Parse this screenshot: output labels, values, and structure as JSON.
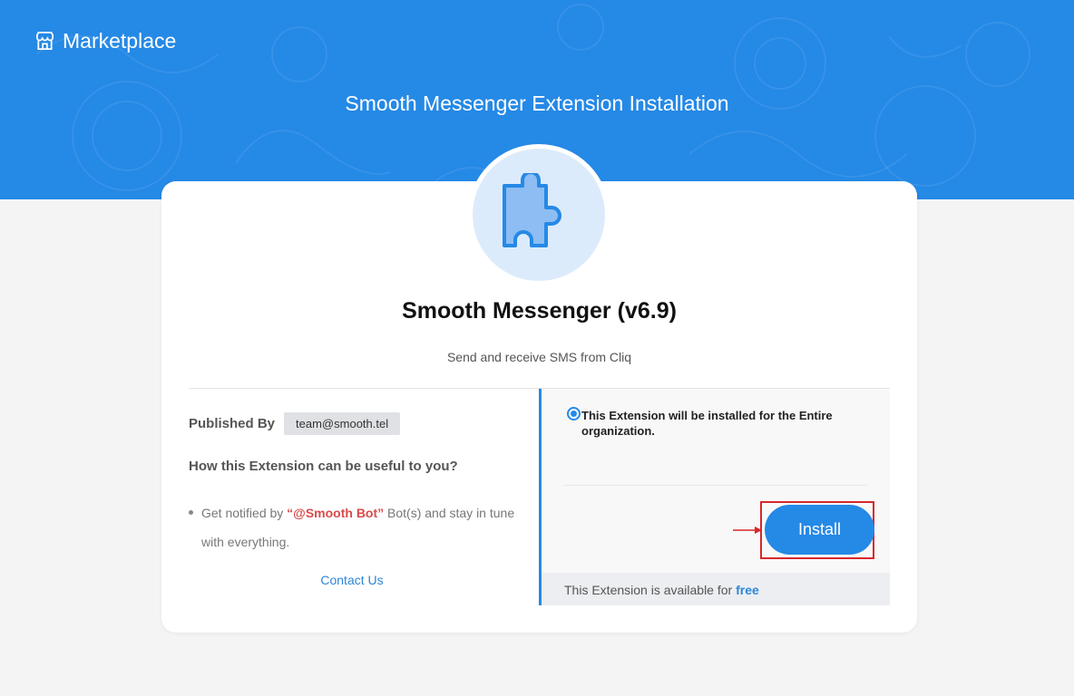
{
  "header": {
    "brand_label": "Marketplace",
    "brand_icon": "store-icon",
    "page_title": "Smooth Messenger Extension Installation"
  },
  "extension": {
    "icon": "puzzle-piece-icon",
    "name": "Smooth Messenger (v6.9)",
    "description": "Send and receive SMS from Cliq"
  },
  "details": {
    "published_by_label": "Published By",
    "publisher_email": "team@smooth.tel",
    "useful_heading": "How this Extension can be useful to you?",
    "bullet_prefix": "Get notified by ",
    "bullet_bot": "“@Smooth Bot”",
    "bullet_suffix": " Bot(s) and stay in tune with everything.",
    "contact_label": "Contact Us"
  },
  "install_panel": {
    "scope_text": "This Extension will be installed for the Entire organization.",
    "scope_selected": true,
    "install_label": "Install",
    "availability_prefix": "This Extension is available for ",
    "availability_price": "free"
  },
  "colors": {
    "brand_blue": "#2589e6",
    "link_blue": "#2d86d9",
    "bot_red": "#d94b4b",
    "highlight_red": "#d9262c"
  }
}
